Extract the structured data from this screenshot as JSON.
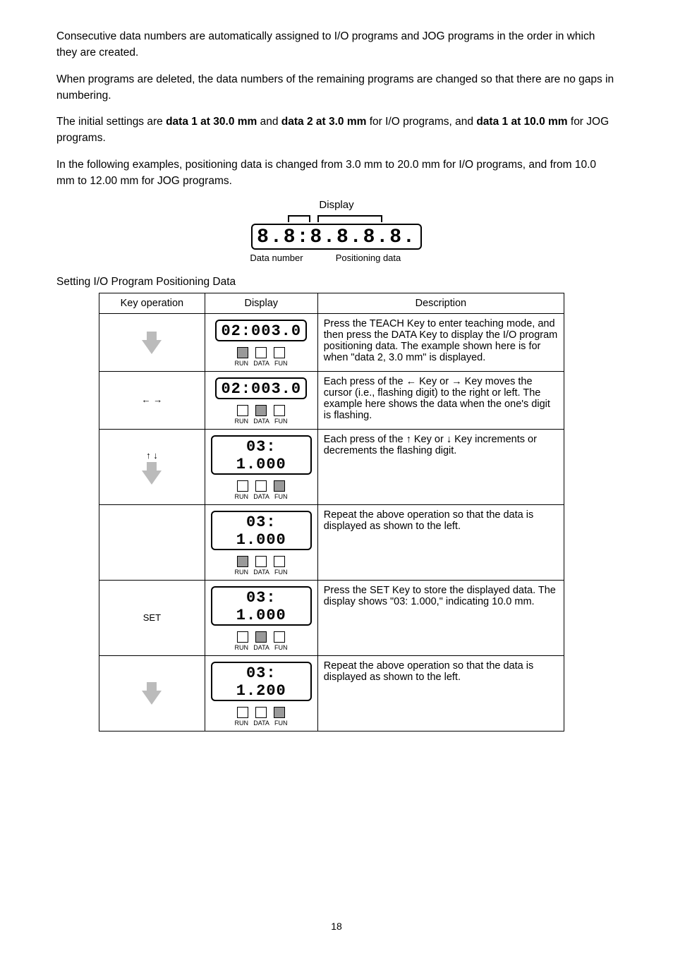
{
  "intro": {
    "para1": "Consecutive data numbers are automatically assigned to I/O programs and JOG programs in the order in which they are created.",
    "para2": "When programs are deleted, the data numbers of the remaining programs are changed so that there are no gaps in numbering.",
    "para3_a": "The initial settings are ",
    "para3_b": "data 1 at 30.0 mm",
    "para3_c": " and ",
    "para3_d": "data 2 at 3.0 mm",
    "para3_e": " for I/O programs, and ",
    "para3_f": "data 1 at 10.0 mm",
    "para3_g": " for JOG programs.",
    "para4": "In the following examples, positioning data is changed from 3.0 mm to 20.0 mm for I/O programs, and from 10.0 mm to 12.00 mm for JOG programs."
  },
  "figure": {
    "caption": "Display",
    "digits": "8.8:8.8.8.8.",
    "label_left": "Data number",
    "label_right": "Positioning data"
  },
  "section_title": "Setting I/O Program Positioning Data",
  "headers": {
    "c1": "Key operation",
    "c2": "Display",
    "c3": "Description"
  },
  "rows": [
    {
      "key_op": "",
      "lcd": "02:003.0",
      "leds": [
        true,
        false,
        false
      ],
      "desc": "Press the TEACH Key to enter teaching mode, and then press the DATA Key to display the I/O program positioning data. The example shown here is for when \"data 2, 3.0 mm\" is displayed."
    },
    {
      "key_op": "← →",
      "lcd": "02:003.0",
      "leds": [
        false,
        true,
        false
      ],
      "desc": "Each press of the ← Key or → Key moves the cursor (i.e., flashing digit) to the right or left. The example here shows the data when the one's digit is flashing."
    },
    {
      "key_op": "↑ ↓",
      "lcd": "03: 1.000",
      "leds": [
        false,
        false,
        true
      ],
      "desc": "Each press of the ↑ Key or ↓ Key increments or decrements the flashing digit."
    },
    {
      "key_op": "",
      "lcd": "03: 1.000",
      "leds": [
        true,
        false,
        false
      ],
      "desc": "Repeat the above operation so that the data is displayed as shown to the left."
    },
    {
      "key_op": "SET",
      "lcd": "03: 1.000",
      "leds": [
        false,
        true,
        false
      ],
      "desc": "Press the SET Key to store the displayed data. The display shows \"03: 1.000,\" indicating 10.0 mm."
    },
    {
      "key_op": "",
      "lcd": "03: 1.200",
      "leds": [
        false,
        false,
        true
      ],
      "desc": "Repeat the above operation so that the data is displayed as shown to the left."
    }
  ],
  "led_names": [
    "RUN",
    "DATA",
    "FUN"
  ],
  "page": "18"
}
